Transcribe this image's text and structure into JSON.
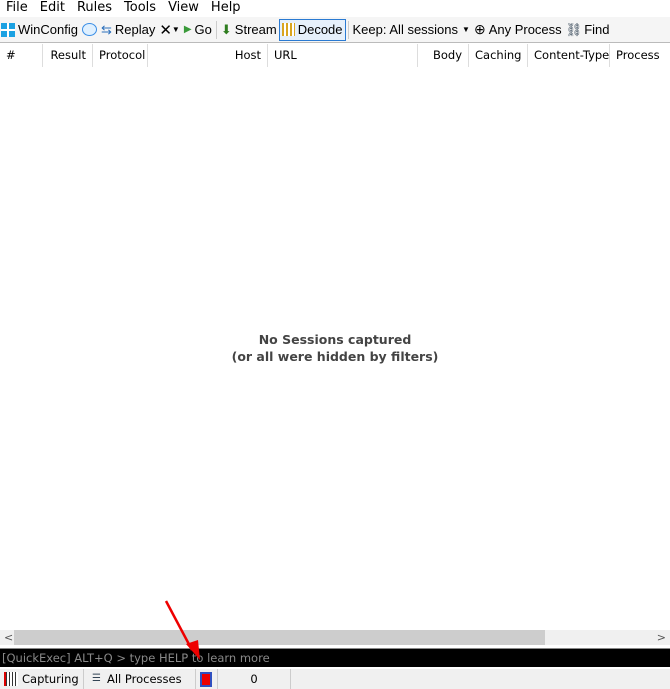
{
  "menu": [
    "File",
    "Edit",
    "Rules",
    "Tools",
    "View",
    "Help"
  ],
  "toolbar": {
    "winconfig": "WinConfig",
    "replay": "Replay",
    "go": "Go",
    "stream": "Stream",
    "decode": "Decode",
    "keep": "Keep: All sessions",
    "any_process": "Any Process",
    "find": "Find"
  },
  "columns": [
    "#",
    "Result",
    "Protocol",
    "Host",
    "URL",
    "Body",
    "Caching",
    "Content-Type",
    "Process"
  ],
  "empty": {
    "line1": "No Sessions captured",
    "line2": "(or all were hidden by filters)"
  },
  "quickexec": {
    "placeholder": "[QuickExec] ALT+Q > type HELP to learn more"
  },
  "status": {
    "capturing": "Capturing",
    "processes": "All Processes",
    "count": "0"
  }
}
